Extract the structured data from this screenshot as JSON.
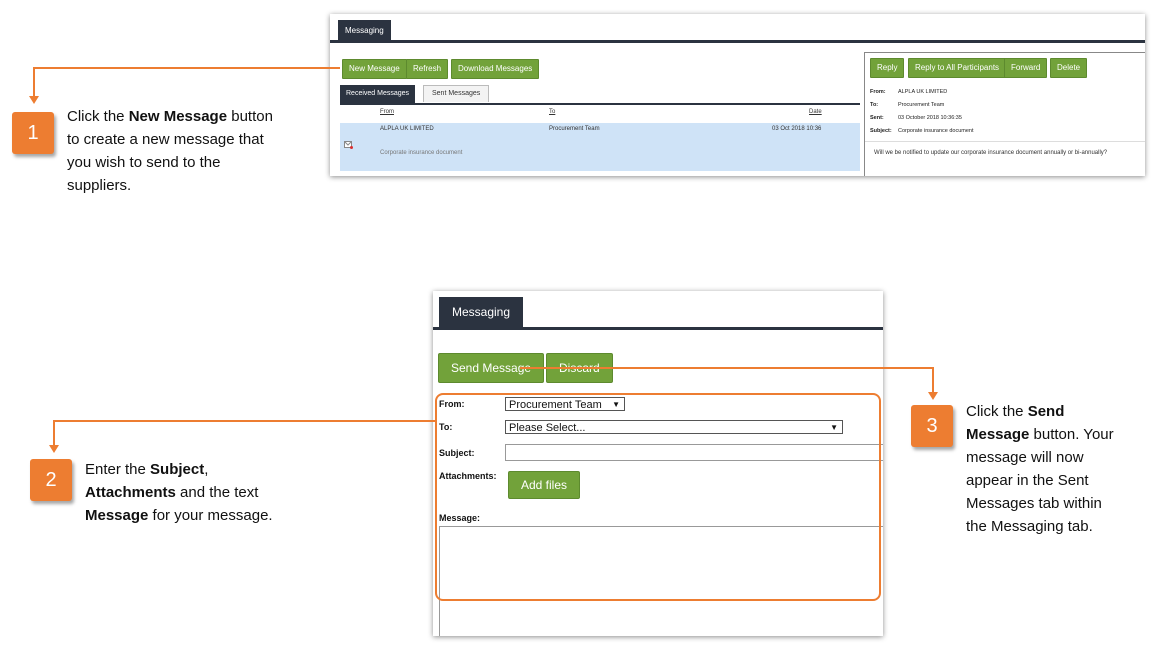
{
  "top_screenshot": {
    "tab_label": "Messaging",
    "buttons": {
      "new_message": "New Message",
      "refresh": "Refresh",
      "download_messages": "Download Messages"
    },
    "subtabs": {
      "received": "Received Messages",
      "sent": "Sent Messages"
    },
    "table": {
      "headers": {
        "from": "From",
        "to": "To",
        "date": "Date"
      },
      "row": {
        "from": "ALPLA UK LIMITED",
        "to": "Procurement Team",
        "date": "03 Oct 2018 10:36",
        "subject": "Corporate insurance document"
      }
    },
    "detail": {
      "buttons": {
        "reply": "Reply",
        "reply_all": "Reply to All Participants",
        "forward": "Forward",
        "delete": "Delete"
      },
      "from_label": "From:",
      "from_value": "ALPLA UK LIMITED",
      "to_label": "To:",
      "to_value": "Procurement Team",
      "sent_label": "Sent:",
      "sent_value": "03 October 2018 10:36:35",
      "subject_label": "Subject:",
      "subject_value": "Corporate insurance document",
      "body": "Will we be notified to update our corporate insurance document annually or bi-annually?"
    }
  },
  "bottom_screenshot": {
    "tab_label": "Messaging",
    "buttons": {
      "send_message": "Send Message",
      "discard": "Discard",
      "add_files": "Add files"
    },
    "form": {
      "from_label": "From:",
      "from_value": "Procurement Team",
      "to_label": "To:",
      "to_value": "Please Select...",
      "subject_label": "Subject:",
      "subject_value": "",
      "attachments_label": "Attachments:",
      "message_label": "Message:",
      "message_value": ""
    }
  },
  "callouts": {
    "step1": {
      "number": "1",
      "pre": "Click the ",
      "bold": "New Message",
      "post": " button to create a new message that you wish to send to the suppliers."
    },
    "step2": {
      "number": "2",
      "pre": "Enter the ",
      "bold1": "Subject",
      "mid1": ",",
      "bold2": "Attachments",
      "mid2": " and the text ",
      "bold3": "Message",
      "post": " for your message."
    },
    "step3": {
      "number": "3",
      "pre": "Click the ",
      "bold": "Send Message",
      "post": " button. Your message will now appear in the Sent Messages tab within the Messaging tab."
    }
  },
  "colors": {
    "accent_orange": "#ed7d31",
    "button_green": "#72a23a",
    "tab_dark": "#2b3340",
    "row_highlight": "#cfe3f7"
  }
}
